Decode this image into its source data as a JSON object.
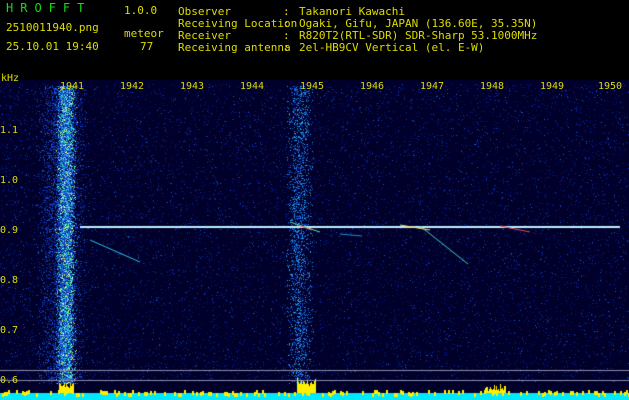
{
  "header": {
    "app_name": "HROFFT",
    "version": "1.0.0",
    "filename": "2510011940.png",
    "datetime": "25.10.01 19:40",
    "count_label": "meteor",
    "count_value": "77",
    "info": [
      {
        "key": "Observer",
        "value": "Takanori Kawachi"
      },
      {
        "key": "Receiving Location",
        "value": "Ogaki, Gifu, JAPAN (136.60E, 35.35N)"
      },
      {
        "key": "Receiver",
        "value": "R820T2(RTL-SDR) SDR-Sharp 53.1000MHz"
      },
      {
        "key": "Receiving antenna",
        "value": "2el-HB9CV Vertical (el. E-W)"
      }
    ]
  },
  "spectrogram": {
    "y_unit": "kHz",
    "y_ticks": [
      "1.1",
      "1.0",
      "0.9",
      "0.8",
      "0.7",
      "0.6"
    ],
    "x_ticks": [
      "1941",
      "1942",
      "1943",
      "1944",
      "1945",
      "1946",
      "1947",
      "1948",
      "1949",
      "1950"
    ],
    "colors": {
      "axis_text": "#dddd00",
      "background": "#00002a",
      "carrier": "#bfefff",
      "baseline": "#00eaff",
      "noise_bars": "#ffee00"
    }
  }
}
